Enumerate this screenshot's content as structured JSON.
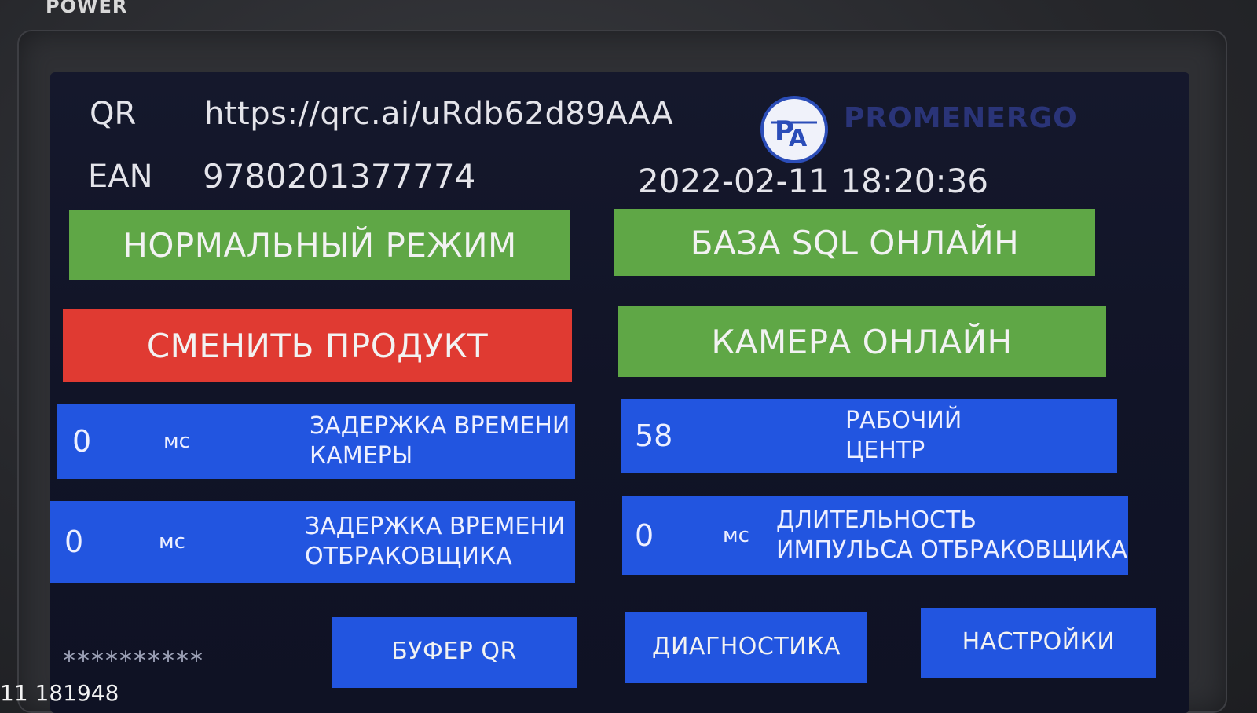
{
  "device": {
    "power_label": "POWER"
  },
  "header": {
    "qr_label": "QR",
    "qr_value": "https://qrc.ai/uRdb62d89AAA",
    "ean_label": "EAN",
    "ean_value": "9780201377774",
    "datetime": "2022-02-11 18:20:36",
    "logo_text": "PROMENERGO"
  },
  "status": {
    "mode_label": "НОРМАЛЬНЫЙ РЕЖИМ",
    "sql_label": "БАЗА SQL ОНЛАЙН",
    "change_product_label": "СМЕНИТЬ ПРОДУКТ",
    "camera_label": "КАМЕРА ОНЛАЙН"
  },
  "params": {
    "camera_delay": {
      "value": "0",
      "unit": "мс",
      "label_line1": "ЗАДЕРЖКА ВРЕМЕНИ",
      "label_line2": "КАМЕРЫ"
    },
    "work_center": {
      "value": "58",
      "label_line1": "РАБОЧИЙ",
      "label_line2": "ЦЕНТР"
    },
    "rejector_delay": {
      "value": "0",
      "unit": "мс",
      "label_line1": "ЗАДЕРЖКА ВРЕМЕНИ",
      "label_line2": "ОТБРАКОВЩИКА"
    },
    "rejector_pulse": {
      "value": "0",
      "unit": "мс",
      "label_line1": "ДЛИТЕЛЬНОСТЬ",
      "label_line2": "ИМПУЛЬСА ОТБРАКОВЩИКА"
    }
  },
  "footer": {
    "password_mask": "**********",
    "qr_buffer_label": "БУФЕР QR",
    "diagnostics_label": "ДИАГНОСТИКА",
    "settings_label": "НАСТРОЙКИ"
  },
  "overlay": {
    "timestamp": "11 181948"
  },
  "colors": {
    "green": "#5fa746",
    "red": "#e03a32",
    "blue": "#2255e0",
    "screen_bg": "#131629"
  }
}
